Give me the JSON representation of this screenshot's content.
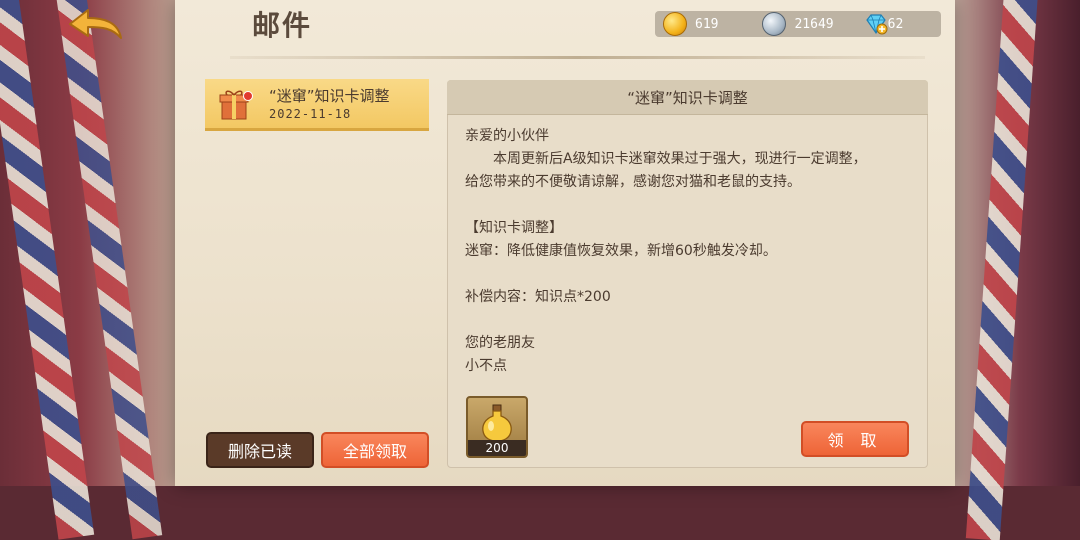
{
  "header": {
    "title": "邮件"
  },
  "currency": {
    "coins": "619",
    "silver": "21649",
    "gems": "62"
  },
  "mail_list": [
    {
      "title": "“迷窜”知识卡调整",
      "date": "2022-11-18",
      "icon": "gift-icon"
    }
  ],
  "mail": {
    "subject": "“迷窜”知识卡调整",
    "greeting": "亲爱的小伙伴",
    "para1": "本周更新后A级知识卡迷窜效果过于强大，现进行一定调整，",
    "para2": "给您带来的不便敬请谅解，感谢您对猫和老鼠的支持。",
    "section": "【知识卡调整】",
    "change": "迷窜：降低健康值恢复效果，新增60秒触发冷却。",
    "compensation": "补偿内容：知识点*200",
    "signoff1": "您的老朋友",
    "signoff2": "小不点"
  },
  "reward": {
    "count": "200",
    "icon": "potion-icon"
  },
  "buttons": {
    "delete_read": "删除已读",
    "claim_all": "全部领取",
    "claim": "领 取"
  },
  "colors": {
    "accent_orange": "#ee6437",
    "selected_item": "#f3c863",
    "dark_button": "#5a3a28"
  }
}
